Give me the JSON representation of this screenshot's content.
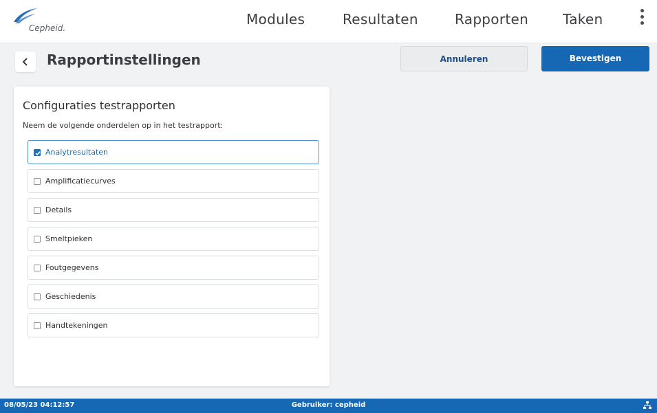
{
  "header": {
    "logo_text": "Cepheid.",
    "nav": [
      "Modules",
      "Resultaten",
      "Rapporten",
      "Taken"
    ],
    "menu_icon": "kebab-menu-icon"
  },
  "toolbar": {
    "title": "Rapportinstellingen",
    "cancel_label": "Annuleren",
    "confirm_label": "Bevestigen",
    "back_icon": "chevron-left-icon"
  },
  "config": {
    "title": "Configuraties testrapporten",
    "subtitle": "Neem de volgende onderdelen op in het testrapport:",
    "options": [
      {
        "label": "Analytresultaten",
        "checked": true
      },
      {
        "label": "Amplificatiecurves",
        "checked": false
      },
      {
        "label": "Details",
        "checked": false
      },
      {
        "label": "Smeltpieken",
        "checked": false
      },
      {
        "label": "Foutgegevens",
        "checked": false
      },
      {
        "label": "Geschiedenis",
        "checked": false
      },
      {
        "label": "Handtekeningen",
        "checked": false
      }
    ]
  },
  "status": {
    "datetime": "08/05/23 04:12:57",
    "user": "Gebruiker: cepheid",
    "network_icon": "network-icon"
  },
  "colors": {
    "accent": "#1768b4",
    "checked_text": "#1f6aa9",
    "background": "#f1f2f4"
  }
}
